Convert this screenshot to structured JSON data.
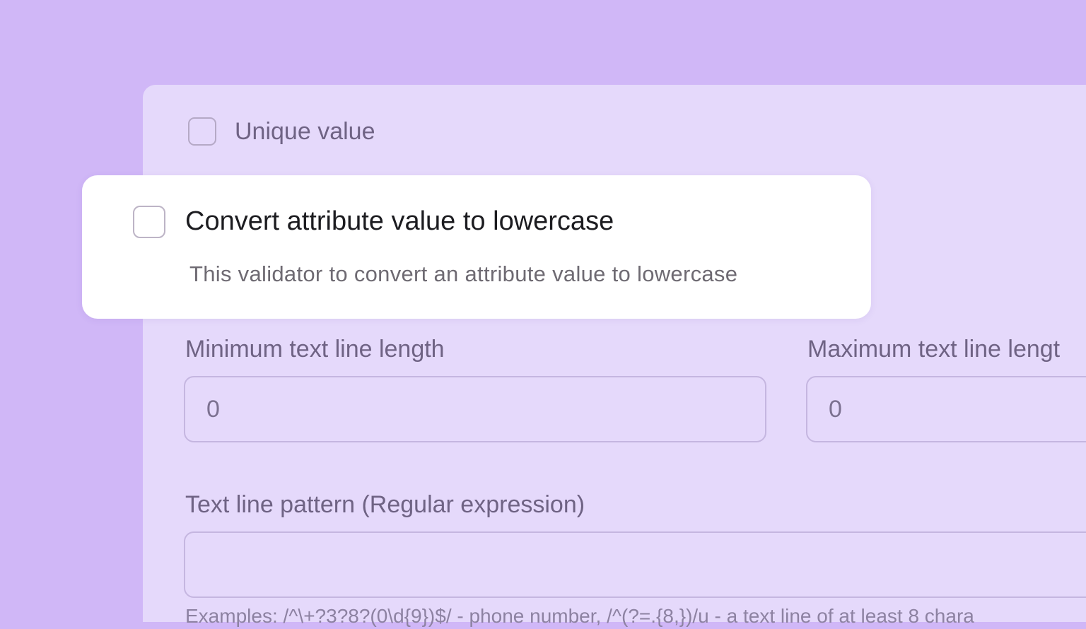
{
  "form": {
    "unique": {
      "label": "Unique value",
      "checked": false
    },
    "lowercase": {
      "label": "Convert attribute value to lowercase",
      "description": "This validator to convert an attribute value to lowercase",
      "checked": false
    },
    "min_length": {
      "label": "Minimum text line length",
      "value": "0"
    },
    "max_length": {
      "label": "Maximum text line lengt",
      "value": "0"
    },
    "pattern": {
      "label": "Text line pattern (Regular expression)",
      "value": "",
      "hint": "Examples: /^\\+?3?8?(0\\d{9})$/ - phone number, /^(?=.{8,})/u - a text line of at least 8 chara"
    }
  },
  "colors": {
    "background": "#d0b7f7",
    "panel": "#e5d9fb",
    "highlight_card": "#ffffff",
    "label_text": "#6f6384",
    "input_border": "#c5b6e0"
  }
}
